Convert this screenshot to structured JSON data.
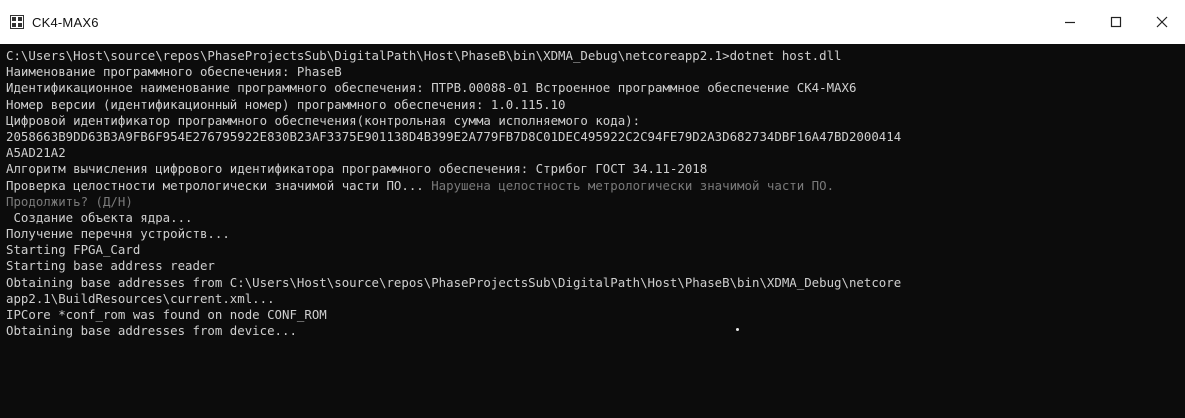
{
  "window": {
    "title": "CK4-MAX6",
    "icon": "console-app-icon",
    "controls": {
      "minimize": "minimize-icon",
      "maximize": "maximize-icon",
      "close": "close-icon"
    }
  },
  "console": {
    "lines": [
      "C:\\Users\\Host\\source\\repos\\PhaseProjectsSub\\DigitalPath\\Host\\PhaseB\\bin\\XDMA_Debug\\netcoreapp2.1>dotnet host.dll",
      "Наименование программного обеспечения: PhaseB",
      "Идентификационное наименование программного обеспечения: ПТРВ.00088-01 Встроенное программное обеспечение СК4-МАХ6",
      "Номер версии (идентификационный номер) программного обеспечения: 1.0.115.10",
      "Цифровой идентификатор программного обеспечения(контрольная сумма исполняемого кода):",
      "2058663B9DD63B3A9FB6F954E276795922E830B23AF3375E901138D4B399E2A779FB7D8C01DEC495922C2C94FE79D2A3D682734DBF16A47BD2000414",
      "A5AD21A2",
      "Алгоритм вычисления цифрового идентификатора программного обеспечения: Стрибог ГОСТ 34.11-2018",
      "Проверка целостности метрологически значимой части ПО...",
      " Нарушена целостность метрологически значимой части ПО.",
      "Продолжить? (Д/Н)",
      " Создание объекта ядра...",
      "Получение перечня устройств...",
      "Starting FPGA_Card",
      "Starting base address reader",
      "Obtaining base addresses from C:\\Users\\Host\\source\\repos\\PhaseProjectsSub\\DigitalPath\\Host\\PhaseB\\bin\\XDMA_Debug\\netcore",
      "app2.1\\BuildResources\\current.xml...",
      "IPCore *conf_rom was found on node CONF_ROM",
      "Obtaining base addresses from device..."
    ]
  }
}
